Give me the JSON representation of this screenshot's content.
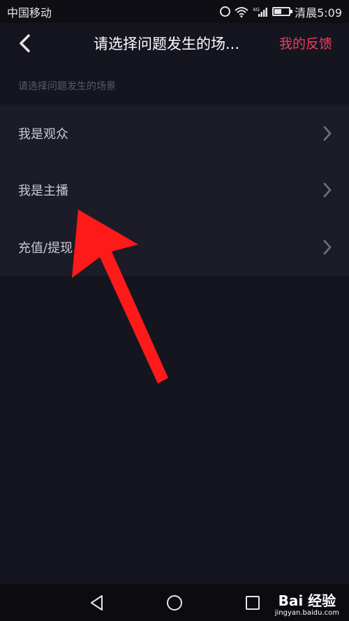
{
  "status_bar": {
    "carrier": "中国移动",
    "network": "4G",
    "time": "清晨5:09",
    "battery_level": 0.45,
    "icons": [
      "alarm-icon",
      "wifi-icon",
      "signal-icon",
      "battery-icon"
    ]
  },
  "navbar": {
    "back_icon": "chevron-left-icon",
    "title": "请选择问题发生的场...",
    "action_label": "我的反馈"
  },
  "section_hint": "请选择问题发生的场景",
  "scenes": [
    {
      "label": "我是观众",
      "icon": "chevron-right-icon"
    },
    {
      "label": "我是主播",
      "icon": "chevron-right-icon"
    },
    {
      "label": "充值/提现",
      "icon": "chevron-right-icon"
    }
  ],
  "annotation": {
    "icon": "red-arrow-annotation",
    "color": "#ff1a1a"
  },
  "bottom_nav": {
    "items": [
      "triangle-back-icon",
      "circle-home-icon",
      "square-recent-icon"
    ]
  },
  "watermark": {
    "brand": "Bai 经验",
    "url": "jingyan.baidu.com"
  },
  "colors": {
    "background": "#15151f",
    "list_background": "#1b1c27",
    "accent": "#f23c5a"
  }
}
